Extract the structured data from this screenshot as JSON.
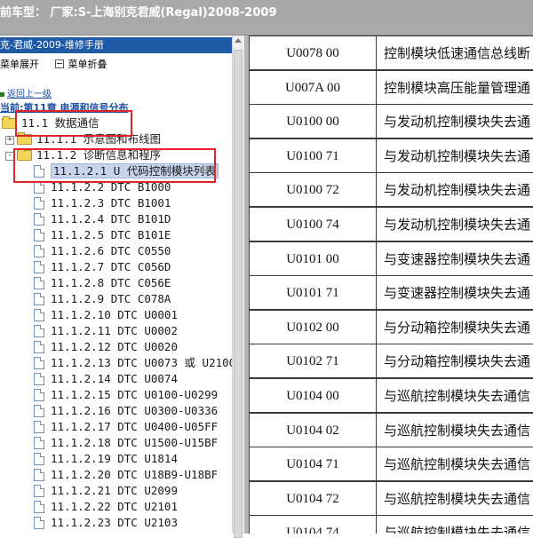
{
  "topbar": {
    "text": "前车型：  厂家:S-上海别克君威(Regal)2008-2009"
  },
  "left_panel": {
    "header": "克-君威-2009-维修手册",
    "toolbar": {
      "expand_label": "菜单展开",
      "collapse_label": "菜单折叠"
    },
    "back_link": "返回上一级",
    "current_chapter": "当前:第11章 电源和信号分布",
    "tree": [
      {
        "label": "11.1 数据通信",
        "kind": "folder",
        "indent": 0
      },
      {
        "label": "11.1.1 示意图和布线图",
        "kind": "folder",
        "indent": 1,
        "expander": "+"
      },
      {
        "label": "11.1.2 诊断信息和程序",
        "kind": "folder",
        "indent": 1,
        "expander": "-"
      },
      {
        "label": "11.1.2.1 U 代码控制模块列表",
        "kind": "doc",
        "selected": true
      },
      {
        "label": "11.1.2.2 DTC B1000",
        "kind": "doc"
      },
      {
        "label": "11.1.2.3 DTC B1001",
        "kind": "doc"
      },
      {
        "label": "11.1.2.4 DTC B101D",
        "kind": "doc"
      },
      {
        "label": "11.1.2.5 DTC B101E",
        "kind": "doc"
      },
      {
        "label": "11.1.2.6 DTC C0550",
        "kind": "doc"
      },
      {
        "label": "11.1.2.7 DTC C056D",
        "kind": "doc"
      },
      {
        "label": "11.1.2.8 DTC C056E",
        "kind": "doc"
      },
      {
        "label": "11.1.2.9 DTC C078A",
        "kind": "doc"
      },
      {
        "label": "11.1.2.10 DTC U0001",
        "kind": "doc"
      },
      {
        "label": "11.1.2.11 DTC U0002",
        "kind": "doc"
      },
      {
        "label": "11.1.2.12 DTC U0020",
        "kind": "doc"
      },
      {
        "label": "11.1.2.13 DTC U0073 或 U2100",
        "kind": "doc"
      },
      {
        "label": "11.1.2.14 DTC U0074",
        "kind": "doc"
      },
      {
        "label": "11.1.2.15 DTC U0100-U0299",
        "kind": "doc"
      },
      {
        "label": "11.1.2.16 DTC U0300-U0336",
        "kind": "doc"
      },
      {
        "label": "11.1.2.17 DTC U0400-U05FF",
        "kind": "doc"
      },
      {
        "label": "11.1.2.18 DTC U1500-U15BF",
        "kind": "doc"
      },
      {
        "label": "11.1.2.19 DTC U1814",
        "kind": "doc"
      },
      {
        "label": "11.1.2.20 DTC U18B9-U18BF",
        "kind": "doc"
      },
      {
        "label": "11.1.2.21 DTC U2099",
        "kind": "doc"
      },
      {
        "label": "11.1.2.22 DTC U2101",
        "kind": "doc"
      },
      {
        "label": "11.1.2.23 DTC U2103",
        "kind": "doc"
      }
    ]
  },
  "table": {
    "rows": [
      {
        "code": "U0078 00",
        "desc": "控制模块低速通信总线断"
      },
      {
        "code": "U007A 00",
        "desc": "控制模块高压能量管理通"
      },
      {
        "code": "U0100 00",
        "desc": "与发动机控制模块失去通"
      },
      {
        "code": "U0100 71",
        "desc": "与发动机控制模块失去通"
      },
      {
        "code": "U0100 72",
        "desc": "与发动机控制模块失去通"
      },
      {
        "code": "U0100 74",
        "desc": "与发动机控制模块失去通"
      },
      {
        "code": "U0101 00",
        "desc": "与变速器控制模块失去通"
      },
      {
        "code": "U0101 71",
        "desc": "与变速器控制模块失去通"
      },
      {
        "code": "U0102 00",
        "desc": "与分动箱控制模块失去通"
      },
      {
        "code": "U0102 71",
        "desc": "与分动箱控制模块失去通"
      },
      {
        "code": "U0104 00",
        "desc": "与巡航控制模块失去通信"
      },
      {
        "code": "U0104 02",
        "desc": "与巡航控制模块失去通信"
      },
      {
        "code": "U0104 71",
        "desc": "与巡航控制模块失去通信"
      },
      {
        "code": "U0104 72",
        "desc": "与巡航控制模块失去通信"
      },
      {
        "code": "U0104 74",
        "desc": "与巡航控制模块失去通信"
      }
    ]
  },
  "colors": {
    "highlight": "#e0262b",
    "header_bg": "#1f5aa6",
    "topbar_bg": "#a9a9a9"
  }
}
